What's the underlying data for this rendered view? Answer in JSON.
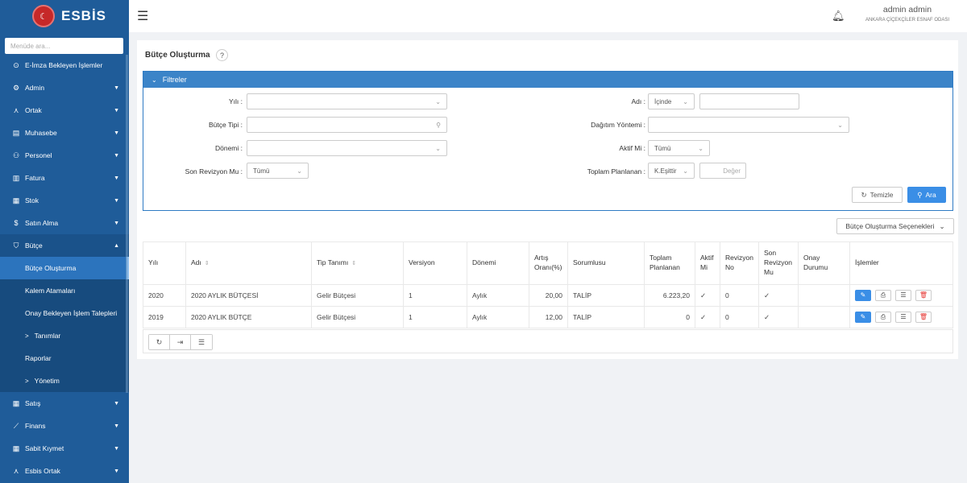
{
  "app": {
    "name": "ESBİS"
  },
  "sidebar": {
    "search_placeholder": "Menüde ara...",
    "items": [
      {
        "label": "E-İmza Bekleyen İşlemler"
      },
      {
        "label": "Admin"
      },
      {
        "label": "Ortak"
      },
      {
        "label": "Muhasebe"
      },
      {
        "label": "Personel"
      },
      {
        "label": "Fatura"
      },
      {
        "label": "Stok"
      },
      {
        "label": "Satın Alma"
      },
      {
        "label": "Bütçe"
      },
      {
        "label": "Satış"
      },
      {
        "label": "Finans"
      },
      {
        "label": "Sabit Kıymet"
      },
      {
        "label": "Esbis Ortak"
      }
    ],
    "sub_items": [
      {
        "label": "Bütçe Oluşturma"
      },
      {
        "label": "Kalem Atamaları"
      },
      {
        "label": "Onay Bekleyen İşlem Talepleri"
      },
      {
        "label": "Tanımlar"
      },
      {
        "label": "Raporlar"
      },
      {
        "label": "Yönetim"
      }
    ]
  },
  "header": {
    "user_name": "admin admin",
    "org": "ANKARA ÇİÇEKÇİLER ESNAF ODASI"
  },
  "page": {
    "title": "Bütçe Oluşturma",
    "help": "?"
  },
  "filters": {
    "title": "Filtreler",
    "year_label": "Yılı :",
    "type_label": "Bütçe Tipi :",
    "period_label": "Dönemi :",
    "revision_label": "Son Revizyon Mu :",
    "revision_value": "Tümü",
    "name_label": "Adı :",
    "name_op": "İçinde",
    "dist_label": "Dağıtım Yöntemi :",
    "active_label": "Aktif Mi :",
    "active_value": "Tümü",
    "planned_label": "Toplam Planlanan :",
    "planned_op": "K.Eşittir",
    "planned_placeholder": "Değer",
    "clear_label": "Temizle",
    "search_label": "Ara"
  },
  "options_label": "Bütçe Oluşturma Seçenekleri",
  "table": {
    "headers": {
      "year": "Yılı",
      "name": "Adı",
      "type": "Tip Tanımı",
      "version": "Versiyon",
      "period": "Dönemi",
      "rate_1": "Artış",
      "rate_2": "Oranı(%)",
      "owner": "Sorumlusu",
      "planned_1": "Toplam",
      "planned_2": "Planlanan",
      "active_1": "Aktif",
      "active_2": "Mi",
      "revno_1": "Revizyon",
      "revno_2": "No",
      "lastrev_1": "Son",
      "lastrev_2": "Revizyon",
      "lastrev_3": "Mu",
      "approval_1": "Onay",
      "approval_2": "Durumu",
      "actions": "İşlemler"
    },
    "rows": [
      {
        "year": "2020",
        "name": "2020 AYLIK BÜTÇESİ",
        "type": "Gelir Bütçesi",
        "version": "1",
        "period": "Aylık",
        "rate": "20,00",
        "owner": "TALİP",
        "planned": "6.223,20",
        "active": "✓",
        "revno": "0",
        "lastrev": "✓",
        "approval": ""
      },
      {
        "year": "2019",
        "name": "2020 AYLIK BÜTÇE",
        "type": "Gelir Bütçesi",
        "version": "1",
        "period": "Aylık",
        "rate": "12,00",
        "owner": "TALİP",
        "planned": "0",
        "active": "✓",
        "revno": "0",
        "lastrev": "✓",
        "approval": ""
      }
    ]
  }
}
